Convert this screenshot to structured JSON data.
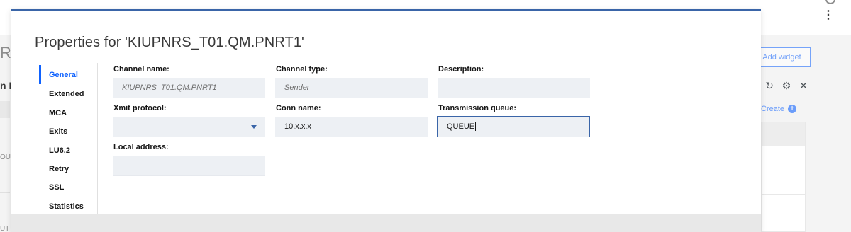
{
  "background": {
    "left_r": "R",
    "left_k": "n K",
    "left_out": "OUT",
    "left_ut": "UT",
    "add_widget_label": "Add widget",
    "icons": [
      "refresh-icon",
      "gear-icon",
      "close-icon"
    ],
    "create_label": "Create"
  },
  "modal": {
    "title": "Properties for 'KIUPNRS_T01.QM.PNRT1'",
    "nav": [
      {
        "label": "General",
        "active": true
      },
      {
        "label": "Extended",
        "active": false
      },
      {
        "label": "MCA",
        "active": false
      },
      {
        "label": "Exits",
        "active": false
      },
      {
        "label": "LU6.2",
        "active": false
      },
      {
        "label": "Retry",
        "active": false
      },
      {
        "label": "SSL",
        "active": false
      },
      {
        "label": "Statistics",
        "active": false
      }
    ],
    "fields": {
      "channel_name": {
        "label": "Channel name:",
        "value": "KIUPNRS_T01.QM.PNRT1"
      },
      "channel_type": {
        "label": "Channel type:",
        "value": "Sender"
      },
      "description": {
        "label": "Description:",
        "value": ""
      },
      "xmit_protocol": {
        "label": "Xmit protocol:",
        "value": ""
      },
      "conn_name": {
        "label": "Conn name:",
        "value": "10.x.x.x"
      },
      "transmission_queue": {
        "label": "Transmission queue:",
        "value": "QUEUE"
      },
      "local_address": {
        "label": "Local address:",
        "value": ""
      }
    }
  },
  "colors": {
    "accent": "#0f62fe",
    "modal_border": "#3a65a8"
  }
}
